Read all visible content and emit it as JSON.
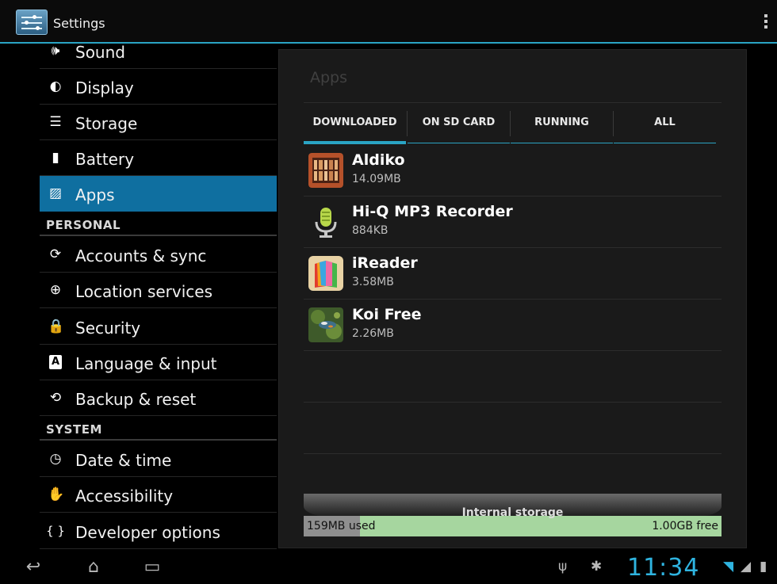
{
  "actionbar": {
    "title": "Settings"
  },
  "sidebar": {
    "items": [
      {
        "label": "Sound",
        "icon": "speaker-icon",
        "glyph": "🕪"
      },
      {
        "label": "Display",
        "icon": "brightness-icon",
        "glyph": "◐"
      },
      {
        "label": "Storage",
        "icon": "storage-icon",
        "glyph": "☰"
      },
      {
        "label": "Battery",
        "icon": "battery-icon",
        "glyph": "▮"
      },
      {
        "label": "Apps",
        "icon": "apps-icon",
        "glyph": "▨",
        "selected": true
      }
    ],
    "personal_header": "PERSONAL",
    "personal_items": [
      {
        "label": "Accounts & sync",
        "icon": "sync-icon",
        "glyph": "⟳"
      },
      {
        "label": "Location services",
        "icon": "location-icon",
        "glyph": "⊕"
      },
      {
        "label": "Security",
        "icon": "lock-icon",
        "glyph": "🔒"
      },
      {
        "label": "Language & input",
        "icon": "keyboard-letter-icon",
        "glyph": "A"
      },
      {
        "label": "Backup & reset",
        "icon": "backup-icon",
        "glyph": "⟲"
      }
    ],
    "system_header": "SYSTEM",
    "system_items": [
      {
        "label": "Date & time",
        "icon": "clock-icon",
        "glyph": "◷"
      },
      {
        "label": "Accessibility",
        "icon": "hand-icon",
        "glyph": "✋"
      },
      {
        "label": "Developer options",
        "icon": "braces-icon",
        "glyph": "{ }"
      }
    ]
  },
  "main": {
    "title": "Apps",
    "tabs": [
      {
        "label": "DOWNLOADED",
        "selected": true
      },
      {
        "label": "ON SD CARD"
      },
      {
        "label": "RUNNING"
      },
      {
        "label": "ALL"
      }
    ],
    "apps": [
      {
        "name": "Aldiko",
        "size": "14.09MB",
        "icon": "aldiko-bookshelf-icon"
      },
      {
        "name": "Hi-Q MP3 Recorder",
        "size": "884KB",
        "icon": "microphone-icon"
      },
      {
        "name": "iReader",
        "size": "3.58MB",
        "icon": "ireader-book-icon"
      },
      {
        "name": "Koi Free",
        "size": "2.26MB",
        "icon": "koi-pond-icon"
      }
    ],
    "storage": {
      "label": "Internal storage",
      "used": "159MB used",
      "free": "1.00GB free",
      "used_fraction": 0.135
    }
  },
  "systembar": {
    "clock": "11:34",
    "nav": [
      {
        "name": "back-icon",
        "glyph": "↩"
      },
      {
        "name": "home-icon",
        "glyph": "⌂"
      },
      {
        "name": "recent-apps-icon",
        "glyph": "▭"
      }
    ],
    "status_icons": [
      {
        "name": "usb-icon",
        "glyph": "ψ"
      },
      {
        "name": "android-debug-icon",
        "glyph": "✱"
      },
      {
        "name": "wifi-icon",
        "glyph": "◥"
      },
      {
        "name": "signal-icon",
        "glyph": "◢"
      },
      {
        "name": "battery-status-icon",
        "glyph": "▮"
      }
    ]
  },
  "colors": {
    "accent": "#2aa4c4",
    "selected_row": "#0f6fa0",
    "clock": "#2fb4e0",
    "storage_free": "#a6d69f",
    "storage_used": "#8f8f8f"
  }
}
